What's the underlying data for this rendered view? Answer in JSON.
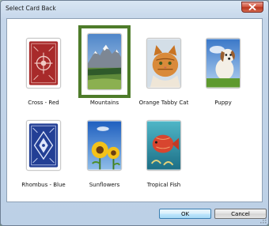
{
  "window": {
    "title": "Select Card Back"
  },
  "cards": [
    {
      "label": "Cross - Red",
      "selected": false,
      "icon": "cross-red-card-back"
    },
    {
      "label": "Mountains",
      "selected": true,
      "icon": "mountains-card-back"
    },
    {
      "label": "Orange Tabby Cat",
      "selected": false,
      "icon": "tabby-cat-card-back"
    },
    {
      "label": "Puppy",
      "selected": false,
      "icon": "puppy-card-back"
    },
    {
      "label": "Rhombus - Blue",
      "selected": false,
      "icon": "rhombus-blue-card-back"
    },
    {
      "label": "Sunflowers",
      "selected": false,
      "icon": "sunflowers-card-back"
    },
    {
      "label": "Tropical Fish",
      "selected": false,
      "icon": "tropical-fish-card-back"
    }
  ],
  "buttons": {
    "ok": "OK",
    "cancel": "Cancel"
  },
  "colors": {
    "selection_border": "#4e7c2a",
    "close_button": "#c0402a",
    "ok_border": "#3c7fb1"
  }
}
